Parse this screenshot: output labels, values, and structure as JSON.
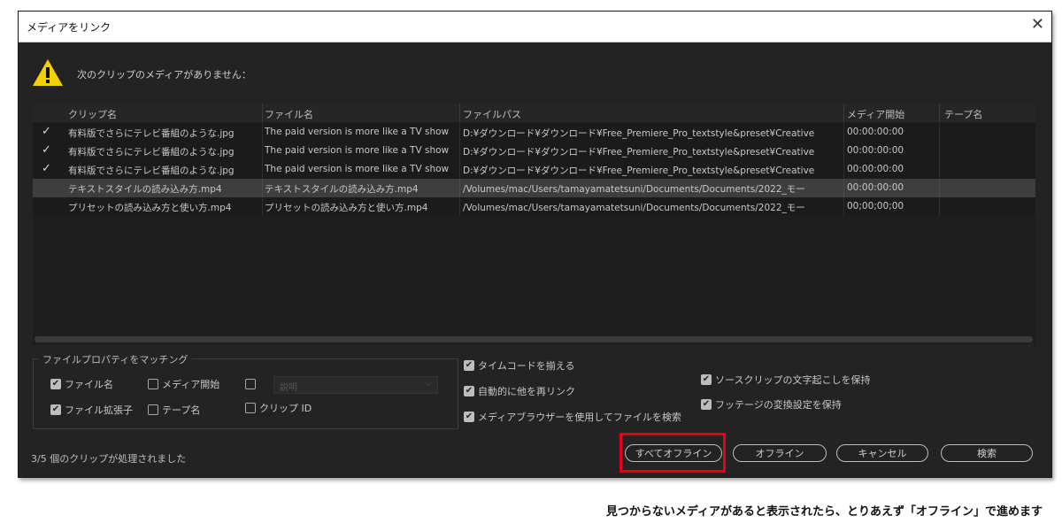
{
  "dialog": {
    "title": "メディアをリンク",
    "close_glyph": "✕",
    "warning_text": "次のクリップのメディアがありません："
  },
  "table": {
    "columns": [
      "クリップ名",
      "ファイル名",
      "ファイルパス",
      "メディア開始",
      "テープ名"
    ],
    "rows": [
      {
        "check": "✓",
        "clip": "有料版でさらにテレビ番組のような.jpg",
        "file": "The paid version is more like a TV show",
        "path": "D:¥ダウンロード¥ダウンロード¥Free_Premiere_Pro_textstyle&preset¥Creative",
        "start": "00:00:00:00",
        "tape": ""
      },
      {
        "check": "✓",
        "clip": "有料版でさらにテレビ番組のような.jpg",
        "file": "The paid version is more like a TV show",
        "path": "D:¥ダウンロード¥ダウンロード¥Free_Premiere_Pro_textstyle&preset¥Creative",
        "start": "00:00:00:00",
        "tape": ""
      },
      {
        "check": "✓",
        "clip": "有料版でさらにテレビ番組のような.jpg",
        "file": "The paid version is more like a TV show",
        "path": "D:¥ダウンロード¥ダウンロード¥Free_Premiere_Pro_textstyle&preset¥Creative",
        "start": "00:00:00:00",
        "tape": ""
      },
      {
        "check": "",
        "clip": "テキストスタイルの読み込み方.mp4",
        "file": "テキストスタイルの読み込み方.mp4",
        "path": "/Volumes/mac/Users/tamayamatetsuni/Documents/Documents/2022_モー",
        "start": "00:00:00:00",
        "tape": ""
      },
      {
        "check": "",
        "clip": "プリセットの読み込み方と使い方.mp4",
        "file": "プリセットの読み込み方と使い方.mp4",
        "path": "/Volumes/mac/Users/tamayamatetsuni/Documents/Documents/2022_モー",
        "start": "00;00;00;00",
        "tape": ""
      }
    ]
  },
  "matching": {
    "legend": "ファイルプロパティをマッチング",
    "file_name": "ファイル名",
    "media_start": "メディア開始",
    "description": "説明",
    "file_ext": "ファイル拡張子",
    "tape_name": "テープ名",
    "clip_id": "クリップ ID"
  },
  "options": {
    "align_timecode": "タイムコードを揃える",
    "auto_relink": "自動的に他を再リンク",
    "use_browser": "メディアブラウザーを使用してファイルを検索",
    "keep_transcript": "ソースクリップの文字起こしを保持",
    "keep_interpret": "フッテージの変換設定を保持"
  },
  "status": "3/5 個のクリップが処理されました",
  "buttons": {
    "all_offline": "すべてオフライン",
    "offline": "オフライン",
    "cancel": "キャンセル",
    "search": "検索"
  },
  "caption": "見つからないメディアがあると表示されたら、とりあえず「オフライン」で進めます",
  "colors": {
    "dialog_bg": "#232323",
    "highlight": "#e3001b",
    "warning": "#f5d000"
  }
}
